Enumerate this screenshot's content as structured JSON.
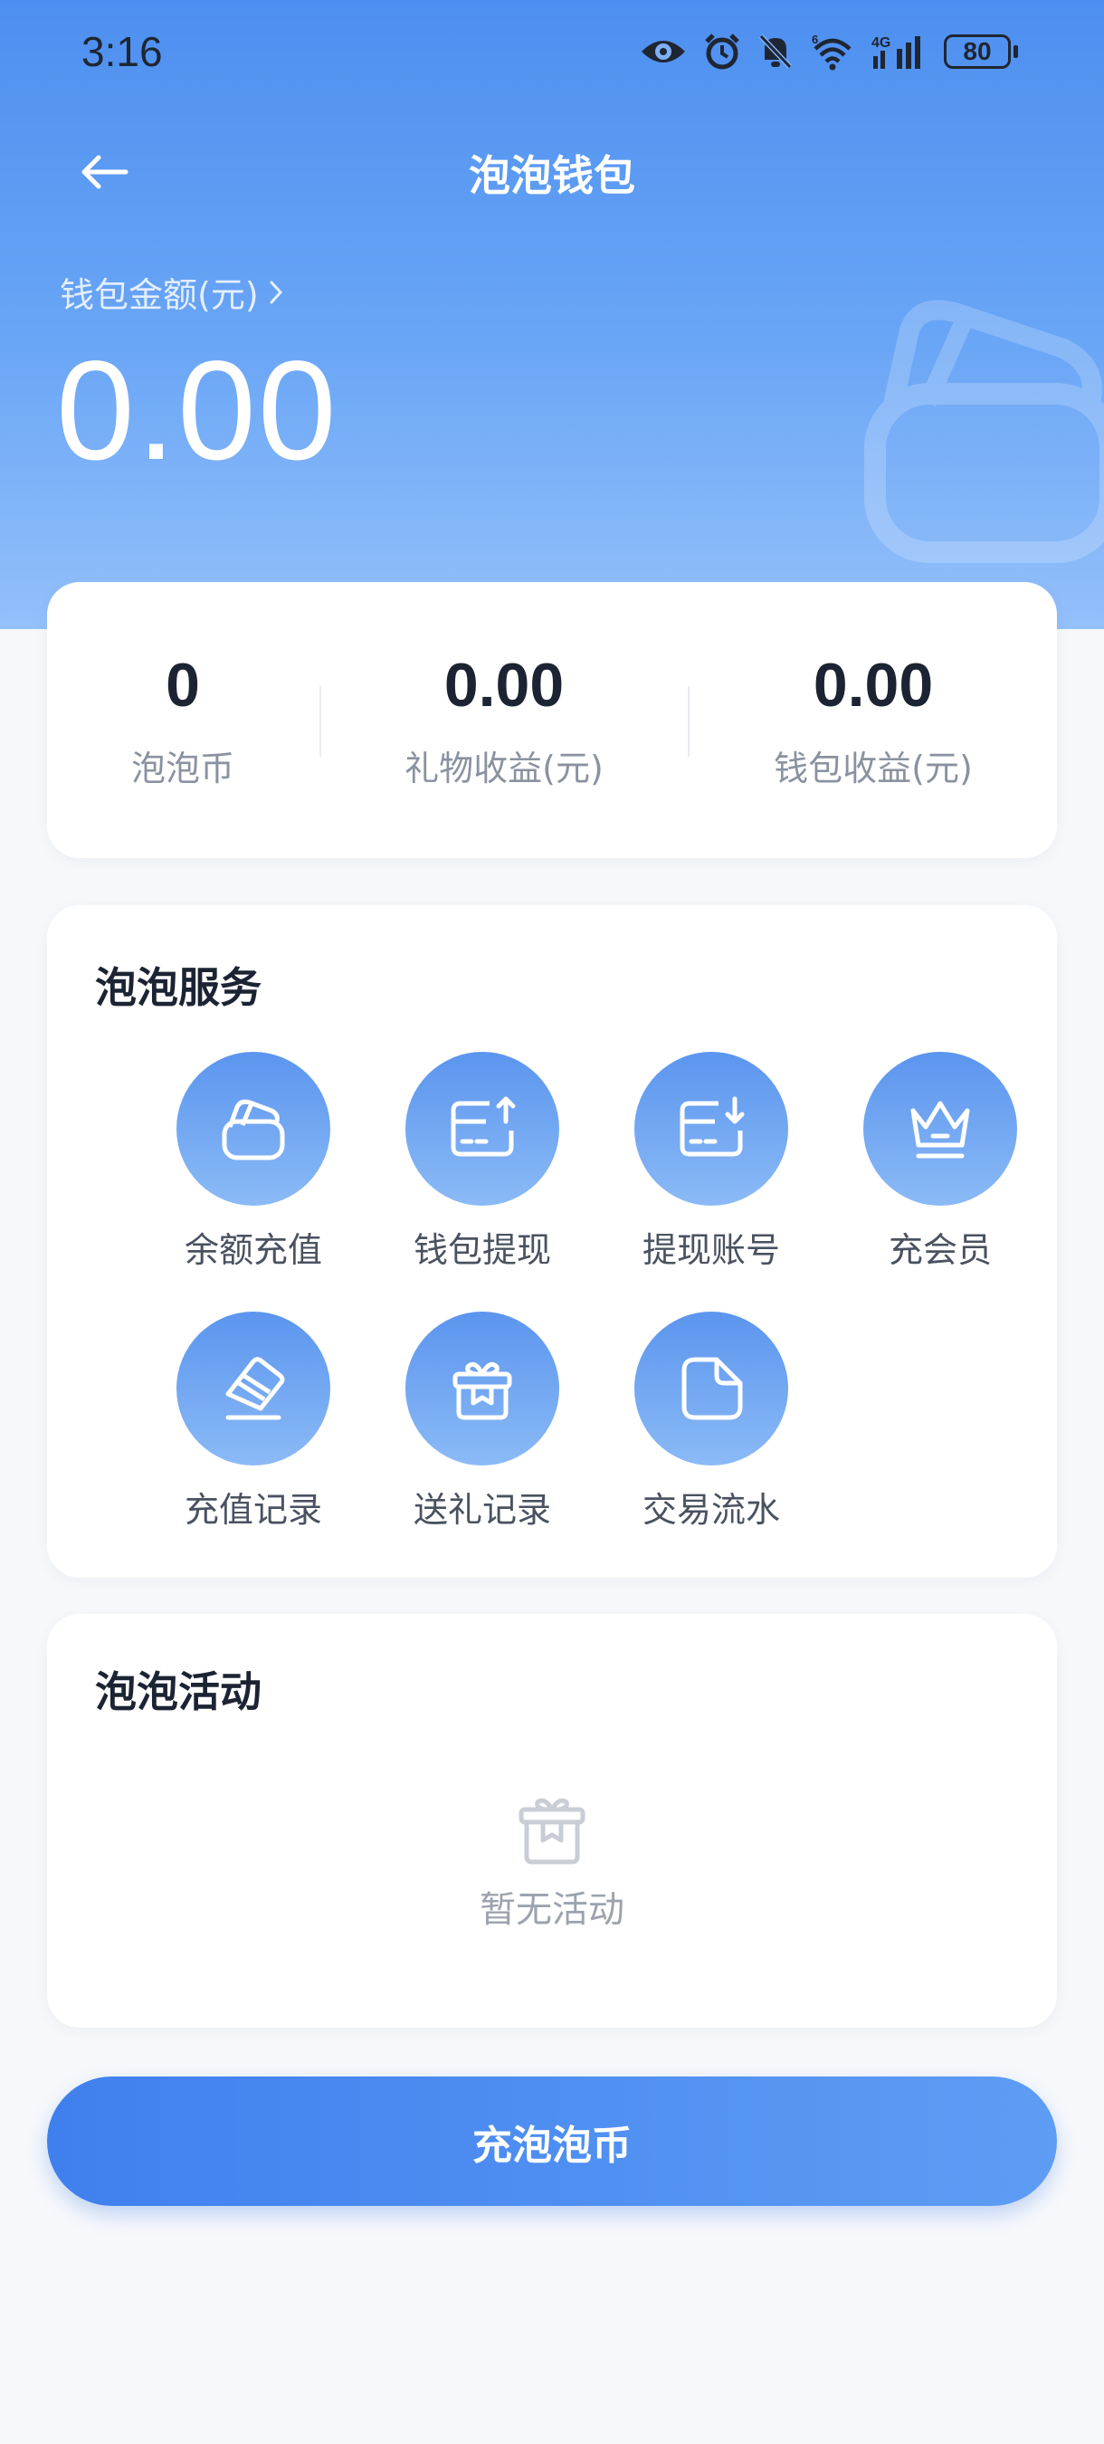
{
  "status_bar": {
    "time": "3:16",
    "battery": "80",
    "icons": [
      "eye-icon",
      "alarm-icon",
      "bell-off-icon",
      "wifi-icon",
      "signal-4g-icon",
      "battery-icon"
    ]
  },
  "header": {
    "title": "泡泡钱包",
    "back_icon": "arrow-left-icon"
  },
  "wallet": {
    "balance_label": "钱包金额(元)",
    "balance_value": "0.00"
  },
  "stats": [
    {
      "value": "0",
      "label": "泡泡币"
    },
    {
      "value": "0.00",
      "label": "礼物收益(元)"
    },
    {
      "value": "0.00",
      "label": "钱包收益(元)"
    }
  ],
  "services": {
    "title": "泡泡服务",
    "items": [
      {
        "label": "余额充值",
        "icon": "wallet-icon"
      },
      {
        "label": "钱包提现",
        "icon": "card-upload-icon"
      },
      {
        "label": "提现账号",
        "icon": "card-download-icon"
      },
      {
        "label": "充会员",
        "icon": "crown-icon"
      },
      {
        "label": "充值记录",
        "icon": "card-record-icon"
      },
      {
        "label": "送礼记录",
        "icon": "gift-icon"
      },
      {
        "label": "交易流水",
        "icon": "document-icon"
      }
    ]
  },
  "activities": {
    "title": "泡泡活动",
    "empty_text": "暂无活动",
    "empty_icon": "gift-box-icon"
  },
  "actions": {
    "recharge_label": "充泡泡币"
  },
  "colors": {
    "accent": "#4a8af0",
    "hero_top": "#4d8ff0",
    "hero_bottom": "#94c0fa",
    "background": "#f6f8fb"
  }
}
